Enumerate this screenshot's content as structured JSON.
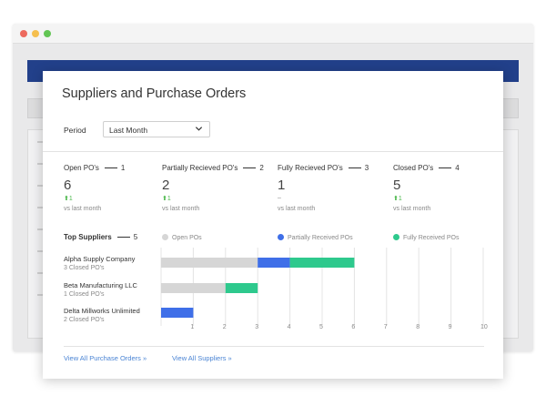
{
  "card": {
    "title": "Suppliers and Purchase Orders",
    "period_label": "Period",
    "period_value": "Last Month"
  },
  "stats": [
    {
      "label": "Open PO's",
      "callout": "1",
      "value": "6",
      "delta": "1",
      "delta_direction": "up",
      "vs": "vs last month"
    },
    {
      "label": "Partially Recieved PO's",
      "callout": "2",
      "value": "2",
      "delta": "1",
      "delta_direction": "up",
      "vs": "vs last month"
    },
    {
      "label": "Fully Recieved PO's",
      "callout": "3",
      "value": "1",
      "delta": "–",
      "delta_direction": "none",
      "vs": "vs last month"
    },
    {
      "label": "Closed PO's",
      "callout": "4",
      "value": "5",
      "delta": "1",
      "delta_direction": "up",
      "vs": "vs last month"
    }
  ],
  "top_suppliers": {
    "heading": "Top Suppliers",
    "callout": "5",
    "legend": [
      "Open POs",
      "Partially Received POs",
      "Fully Received POs"
    ],
    "suppliers": [
      {
        "name": "Alpha Supply Company",
        "sub": "3 Closed PO's"
      },
      {
        "name": "Beta Manufacturing LLC",
        "sub": "1 Closed PO's"
      },
      {
        "name": "Delta Millworks Unlimited",
        "sub": "2 Closed PO's"
      }
    ]
  },
  "chart_data": {
    "type": "bar",
    "orientation": "horizontal",
    "stacked": true,
    "categories": [
      "Alpha Supply Company",
      "Beta Manufacturing LLC",
      "Delta Millworks Unlimited"
    ],
    "series": [
      {
        "name": "Open POs",
        "color": "#d6d6d6",
        "values": [
          3,
          2,
          0
        ]
      },
      {
        "name": "Partially Received POs",
        "color": "#3f6fe8",
        "values": [
          1,
          0,
          1
        ]
      },
      {
        "name": "Fully Received POs",
        "color": "#2ec98d",
        "values": [
          2,
          1,
          0
        ]
      }
    ],
    "xticks": [
      1,
      2,
      3,
      4,
      5,
      6,
      7,
      8,
      9,
      10
    ],
    "xlim": [
      0,
      10
    ],
    "grid": true,
    "legend_position": "top"
  },
  "footer": {
    "link_orders": "View All Purchase Orders »",
    "link_suppliers": "View All Suppliers »"
  },
  "colors": {
    "accent_link": "#4a84d4",
    "delta_up": "#4cb84c",
    "nav_blue": "#22408a"
  }
}
